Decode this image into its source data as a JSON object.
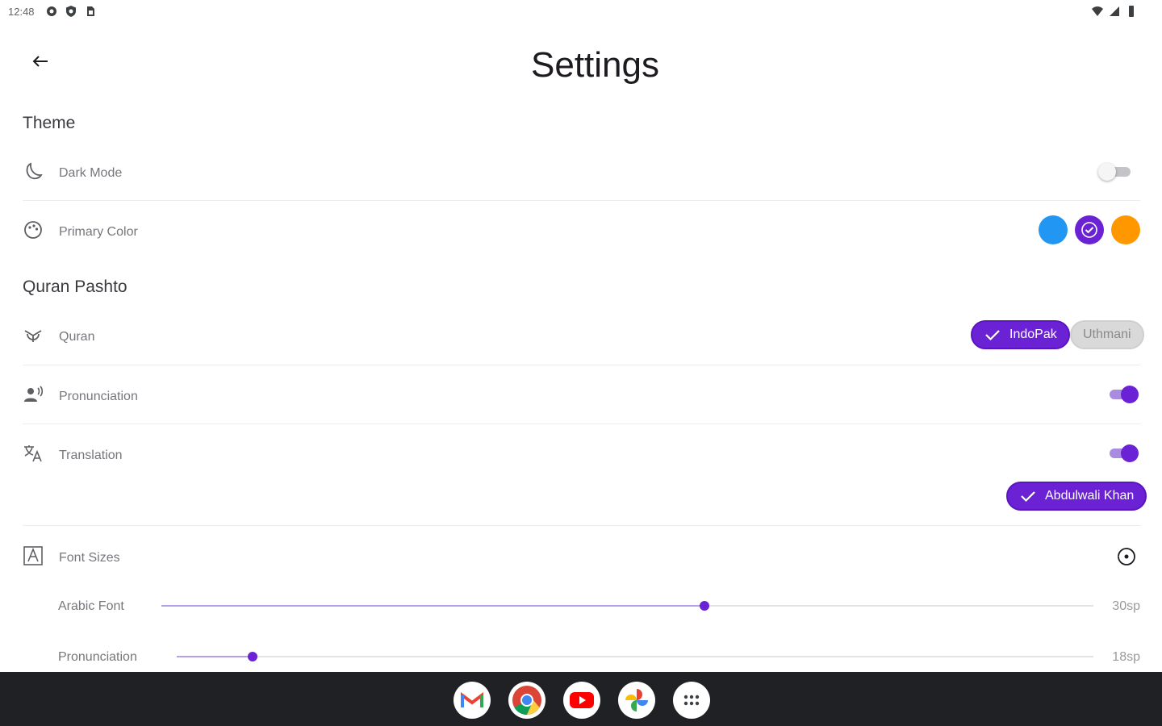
{
  "status": {
    "time": "12:48",
    "left_icons": [
      "settings-icon",
      "shield-icon",
      "sim-card-icon"
    ],
    "right_icons": [
      "wifi-icon",
      "signal-icon",
      "battery-icon"
    ]
  },
  "header": {
    "title": "Settings",
    "back_icon": "arrow-back-icon"
  },
  "theme": {
    "section_title": "Theme",
    "dark_mode": {
      "label": "Dark Mode",
      "icon": "moon-icon",
      "enabled": false
    },
    "primary_color": {
      "label": "Primary Color",
      "icon": "palette-icon",
      "options": [
        "#2196f3",
        "#6a22d4",
        "#ff9800"
      ],
      "selected": "#6a22d4"
    }
  },
  "quran_pashto": {
    "section_title": "Quran Pashto",
    "quran": {
      "label": "Quran",
      "icon": "mosque-icon",
      "options": [
        {
          "label": "IndoPak",
          "selected": true
        },
        {
          "label": "Uthmani",
          "selected": false
        }
      ]
    },
    "pronunciation": {
      "label": "Pronunciation",
      "icon": "record-voice-icon",
      "enabled": true
    },
    "translation": {
      "label": "Translation",
      "icon": "translate-icon",
      "enabled": true,
      "translator": {
        "label": "Abdulwali Khan",
        "selected": true
      }
    },
    "font_sizes": {
      "label": "Font Sizes",
      "icon": "font-size-icon",
      "reset_icon": "reset-icon",
      "sliders": [
        {
          "label": "Arabic Font",
          "value": "30sp",
          "fraction": 0.583
        },
        {
          "label": "Pronunciation",
          "value": "18sp",
          "fraction": 0.083
        }
      ]
    }
  },
  "colors": {
    "accent": "#6a22d4",
    "accent_light": "#a98be0",
    "nav_bg": "#202124"
  },
  "dock": {
    "apps": [
      "gmail-icon",
      "chrome-icon",
      "youtube-icon",
      "photos-icon",
      "app-drawer-icon"
    ]
  }
}
